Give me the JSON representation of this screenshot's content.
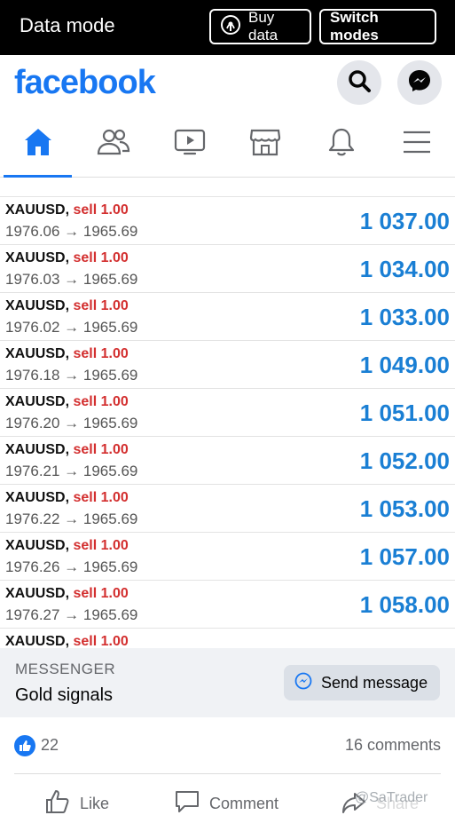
{
  "system_bar": {
    "title": "Data mode",
    "buy_label": "Buy data",
    "switch_label": "Switch modes"
  },
  "header": {
    "logo": "facebook",
    "search_icon": "search-icon",
    "messenger_icon": "messenger-icon"
  },
  "nav": {
    "tabs": [
      "home-icon",
      "friends-icon",
      "watch-icon",
      "marketplace-icon",
      "notifications-icon",
      "menu-icon"
    ],
    "active": "home-icon",
    "accent": "#1877f2"
  },
  "trades": [
    {
      "symbol": "XAUUSD,",
      "action": "sell 1.00",
      "prices": "1976.06 → 1965.69",
      "profit": "1 037.00"
    },
    {
      "symbol": "XAUUSD,",
      "action": "sell 1.00",
      "prices": "1976.03 → 1965.69",
      "profit": "1 034.00"
    },
    {
      "symbol": "XAUUSD,",
      "action": "sell 1.00",
      "prices": "1976.02 → 1965.69",
      "profit": "1 033.00"
    },
    {
      "symbol": "XAUUSD,",
      "action": "sell 1.00",
      "prices": "1976.18 → 1965.69",
      "profit": "1 049.00"
    },
    {
      "symbol": "XAUUSD,",
      "action": "sell 1.00",
      "prices": "1976.20 → 1965.69",
      "profit": "1 051.00"
    },
    {
      "symbol": "XAUUSD,",
      "action": "sell 1.00",
      "prices": "1976.21 → 1965.69",
      "profit": "1 052.00"
    },
    {
      "symbol": "XAUUSD,",
      "action": "sell 1.00",
      "prices": "1976.22 → 1965.69",
      "profit": "1 053.00"
    },
    {
      "symbol": "XAUUSD,",
      "action": "sell 1.00",
      "prices": "1976.26 → 1965.69",
      "profit": "1 057.00"
    },
    {
      "symbol": "XAUUSD,",
      "action": "sell 1.00",
      "prices": "1976.27 → 1965.69",
      "profit": "1 058.00"
    },
    {
      "symbol": "XAUUSD,",
      "action": "sell 1.00",
      "prices": "",
      "profit": ""
    }
  ],
  "messenger": {
    "label": "MESSENGER",
    "name": "Gold signals",
    "send_label": "Send message"
  },
  "reactions": {
    "like_count": "22",
    "comments": "16 comments"
  },
  "actions": {
    "like": "Like",
    "comment": "Comment",
    "share": "Share"
  },
  "watermark": "@SaTrader",
  "colors": {
    "profit": "#1a7fd4",
    "sell": "#d32f2f",
    "brand": "#1877f2"
  }
}
